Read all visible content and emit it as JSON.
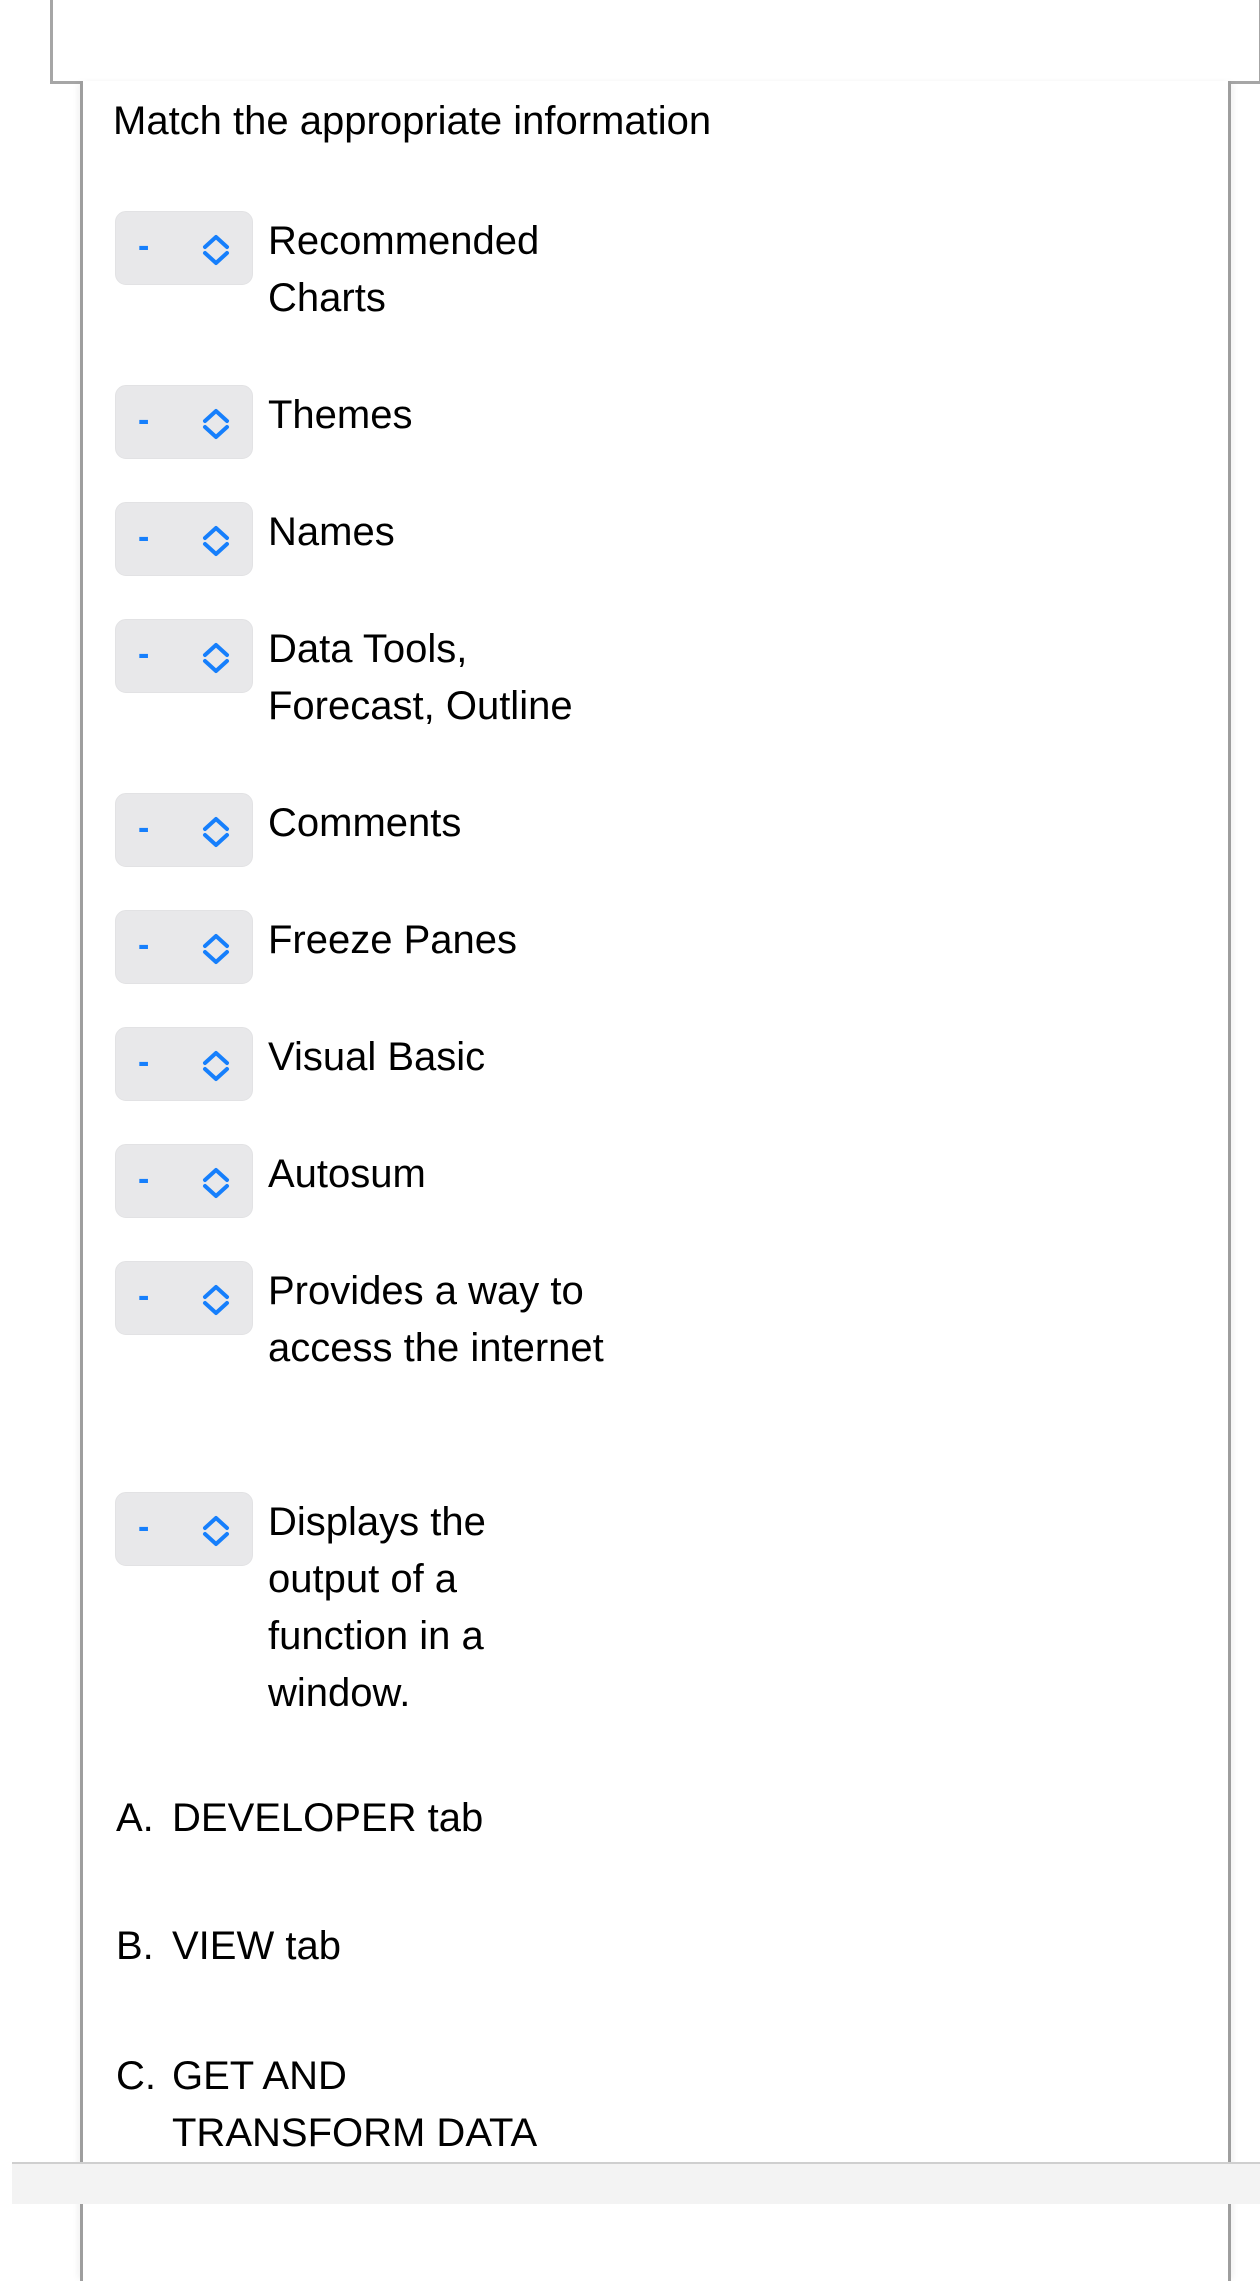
{
  "question": {
    "prompt": "Match the appropriate information",
    "items": [
      {
        "selected": "-",
        "label": "Recommended Charts"
      },
      {
        "selected": "-",
        "label": "Themes"
      },
      {
        "selected": "-",
        "label": "Names"
      },
      {
        "selected": "-",
        "label": "Data Tools, Forecast, Outline"
      },
      {
        "selected": "-",
        "label": "Comments"
      },
      {
        "selected": "-",
        "label": "Freeze Panes"
      },
      {
        "selected": "-",
        "label": "Visual Basic"
      },
      {
        "selected": "-",
        "label": "Autosum"
      },
      {
        "selected": "-",
        "label": "Provides a way to access the internet"
      },
      {
        "selected": "-",
        "label": "Displays the output of a function in a window."
      }
    ],
    "options": [
      {
        "letter": "A.",
        "text": "DEVELOPER tab"
      },
      {
        "letter": "B.",
        "text": "VIEW tab"
      },
      {
        "letter": "C.",
        "text": "GET AND TRANSFORM DATA"
      }
    ]
  },
  "colors": {
    "accent": "#167ffc",
    "select_bg": "#e8e8ea",
    "border": "#a6a6a6"
  },
  "icons": {
    "select_indicator": "chevron-up-down-icon"
  }
}
